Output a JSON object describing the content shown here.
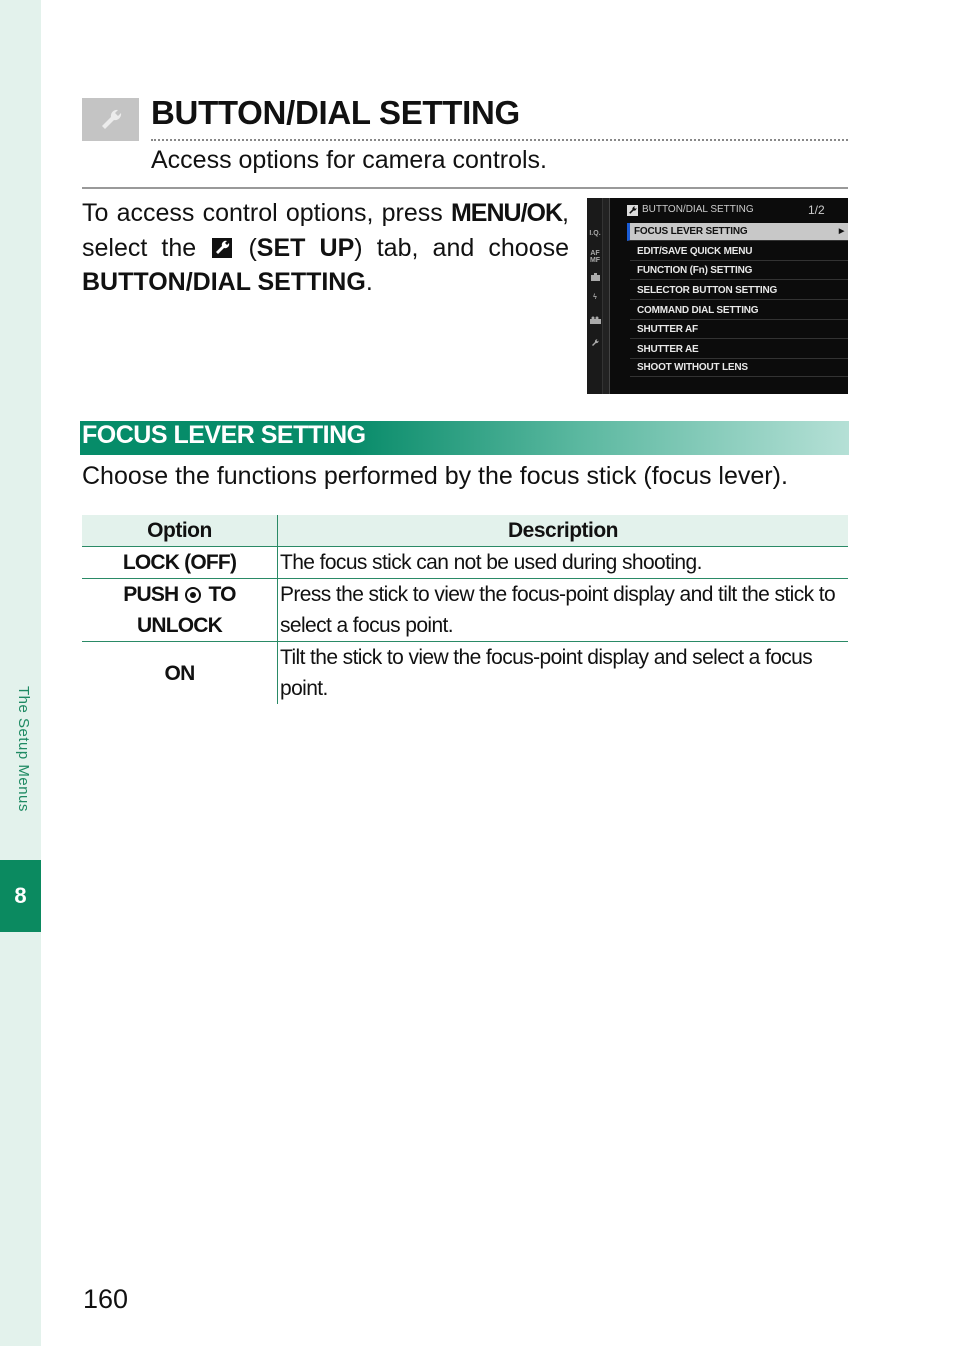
{
  "sidebar": {
    "chapter_label": "The Setup Menus",
    "chapter_number": "8"
  },
  "header": {
    "icon": "wrench-icon",
    "title": "BUTTON/DIAL SETTING",
    "subtitle": "Access options for camera controls."
  },
  "intro": {
    "part1": "To access control options, press ",
    "menu_key": "MENU/OK",
    "part2": ", select the ",
    "tab_icon": "wrench-icon",
    "part3": " (",
    "tab_name": "SET UP",
    "part4": ") tab, and choose ",
    "item_name": "BUTTON/DIAL SETTING",
    "part5": "."
  },
  "camera_screen": {
    "header": "BUTTON/DIAL SETTING",
    "page": "1/2",
    "tab_icons": [
      "I.Q.",
      "AF MF",
      "camera-icon",
      "flash-icon",
      "movie-icon",
      "wrench-icon"
    ],
    "items": [
      {
        "label": "FOCUS LEVER SETTING",
        "selected": true
      },
      {
        "label": "EDIT/SAVE QUICK MENU",
        "selected": false
      },
      {
        "label": "FUNCTION (Fn) SETTING",
        "selected": false
      },
      {
        "label": "SELECTOR BUTTON SETTING",
        "selected": false
      },
      {
        "label": "COMMAND DIAL SETTING",
        "selected": false
      },
      {
        "label": "SHUTTER AF",
        "selected": false
      },
      {
        "label": "SHUTTER AE",
        "selected": false
      },
      {
        "label": "SHOOT WITHOUT LENS",
        "selected": false
      }
    ],
    "colors": {
      "selection_bar": "#1a5cd6",
      "selected_bg": "#c8c8c8"
    }
  },
  "section": {
    "title": "FOCUS LEVER SETTING",
    "description": "Choose the functions performed by the focus stick (focus lever).",
    "accent_color": "#068c69"
  },
  "table": {
    "headers": {
      "option": "Option",
      "description": "Description"
    },
    "rows": [
      {
        "option": "LOCK (OFF)",
        "description": "The focus stick can not be used during shooting."
      },
      {
        "option_pre": "PUSH",
        "option_icon": "focus-stick-icon",
        "option_post": "TO UNLOCK",
        "description": "Press the stick to view the focus-point display and tilt the stick to select a focus point."
      },
      {
        "option": "ON",
        "description": "Tilt the stick to view the focus-point display and select a focus point."
      }
    ]
  },
  "footer": {
    "page_number": "160"
  }
}
